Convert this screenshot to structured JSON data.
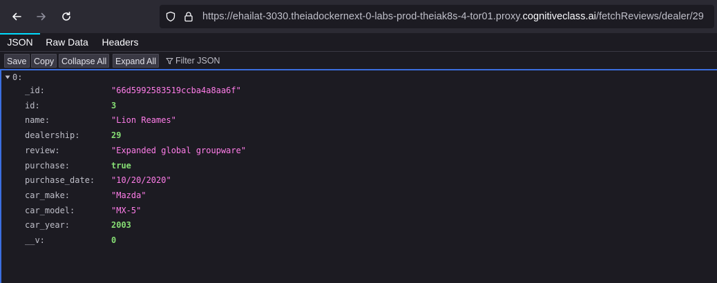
{
  "browser": {
    "back_icon": "arrow-left-icon",
    "forward_icon": "arrow-right-icon",
    "reload_icon": "reload-icon",
    "url_prefix": "https://ehailat-3030.theiadockernext-0-labs-prod-theiak8s-4-tor01.proxy.",
    "url_host": "cognitiveclass.ai",
    "url_path": "/fetchReviews/dealer/29"
  },
  "tabs": [
    {
      "label": "JSON",
      "active": true
    },
    {
      "label": "Raw Data",
      "active": false
    },
    {
      "label": "Headers",
      "active": false
    }
  ],
  "toolbar": {
    "save": "Save",
    "copy": "Copy",
    "collapse_all": "Collapse All",
    "expand_all": "Expand All",
    "filter_placeholder": "Filter JSON"
  },
  "json": {
    "root_label": "0:",
    "rows": [
      {
        "key": "_id:",
        "value": "\"66d5992583519ccba4a8aa6f\"",
        "type": "string"
      },
      {
        "key": "id:",
        "value": "3",
        "type": "number"
      },
      {
        "key": "name:",
        "value": "\"Lion Reames\"",
        "type": "string"
      },
      {
        "key": "dealership:",
        "value": "29",
        "type": "number"
      },
      {
        "key": "review:",
        "value": "\"Expanded global groupware\"",
        "type": "string"
      },
      {
        "key": "purchase:",
        "value": "true",
        "type": "boolean"
      },
      {
        "key": "purchase_date:",
        "value": "\"10/20/2020\"",
        "type": "string"
      },
      {
        "key": "car_make:",
        "value": "\"Mazda\"",
        "type": "string"
      },
      {
        "key": "car_model:",
        "value": "\"MX-5\"",
        "type": "string"
      },
      {
        "key": "car_year:",
        "value": "2003",
        "type": "number"
      },
      {
        "key": "__v:",
        "value": "0",
        "type": "number"
      }
    ]
  },
  "colors": {
    "string": "#ff7de9",
    "number": "#86de74",
    "accent": "#3b6fe0"
  }
}
